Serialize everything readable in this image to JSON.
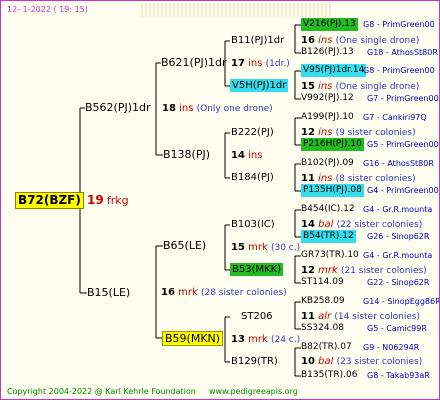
{
  "header": {
    "date": "12-   1-2022  ( 19: 15)"
  },
  "footer": {
    "copyright": "Copyright 2004-2022 @ Karl Kehrle Foundation",
    "site": "www.pedigreeapis.org"
  },
  "root": {
    "id": "B72(BZF)",
    "gen": "19",
    "tag": "frkg"
  },
  "level1": [
    {
      "id": "B562(PJ)1dr",
      "gen": "18",
      "tag": "ins",
      "note": "(Only one drone)"
    },
    {
      "id": "B15(LE)",
      "gen": "16",
      "tag": "mrk",
      "note": "(28 sister colonies)"
    }
  ],
  "level2": [
    {
      "id": "B621(PJ)1dr",
      "gen": "17",
      "tag": "ins",
      "note": "(1dr.)"
    },
    {
      "id": "B138(PJ)",
      "gen": "14",
      "tag": "ins",
      "note": ""
    },
    {
      "id": "B65(LE)",
      "gen": "15",
      "tag": "mrk",
      "note": "(30 c.)"
    },
    {
      "id": "B59(MKN)",
      "gen": "13",
      "tag": "mrk",
      "note": "(24 c.)"
    }
  ],
  "level3": [
    {
      "id": "B11(PJ)1dr",
      "gen": "16",
      "tag": "ins",
      "note": "(One single drone)"
    },
    {
      "id": "V5H(PJ)1dr",
      "gen": "15",
      "tag": "ins",
      "note": "(One single drone)"
    },
    {
      "id": "B222(PJ)",
      "gen": "12",
      "tag": "ins",
      "note": "(9 sister colonies)"
    },
    {
      "id": "B184(PJ)",
      "gen": "11",
      "tag": "ins",
      "note": "(8 sister colonies)"
    },
    {
      "id": "B103(IC)",
      "gen": "14",
      "tag": "bal",
      "note": "(22 sister colonies)"
    },
    {
      "id": "B53(MKK)",
      "gen": "12",
      "tag": "mrk",
      "note": "(21 sister colonies)"
    },
    {
      "id": "ST206",
      "gen": "11",
      "tag": "alr",
      "note": "(14 sister colonies)"
    },
    {
      "id": "B129(TR)",
      "gen": "10",
      "tag": "bal",
      "note": "(23 sister colonies)"
    }
  ],
  "level4": [
    {
      "id": "V216(PJ).13",
      "info": "G8 - PrimGreen00"
    },
    {
      "id": "B126(PJ).13",
      "info": "G18 - AthosSt80R"
    },
    {
      "id": "V95(PJ)1dr.14",
      "info": "G8 - PrimGreen00"
    },
    {
      "id": "V992(PJ).12",
      "info": "G7 - PrimGreen00"
    },
    {
      "id": "A199(PJ).10",
      "info": "G7 - Cankiri97Q"
    },
    {
      "id": "P216H(PJ).10",
      "info": "G5 - PrimGreen00"
    },
    {
      "id": "B102(PJ).09",
      "info": "G16 - AthosSt80R"
    },
    {
      "id": "P135H(PJ).08",
      "info": "G4 - PrimGreen00"
    },
    {
      "id": "B454(IC).12",
      "info": "G4 - Gr.R.mounta"
    },
    {
      "id": "B54(TR).12",
      "info": "G26 - Sinop62R"
    },
    {
      "id": "GR73(TR).10",
      "info": "G4 - Gr.R.mounta"
    },
    {
      "id": "ST114.09",
      "info": "G22 - Sinop62R"
    },
    {
      "id": "KB258.09",
      "info": "G14 - SinopEgg86R"
    },
    {
      "id": "SS324.08",
      "info": "G5 - Camic99R"
    },
    {
      "id": "B82(TR).07",
      "info": "G9 - N06294R"
    },
    {
      "id": "B135(TR).06",
      "info": "G8 - Takab93aR"
    }
  ]
}
